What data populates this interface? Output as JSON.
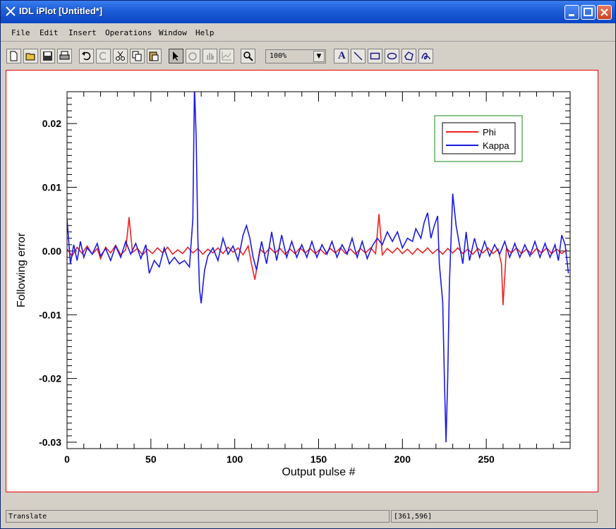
{
  "window": {
    "title": "IDL iPlot [Untitled*]"
  },
  "menu": [
    "File",
    "Edit",
    "Insert",
    "Operations",
    "Window",
    "Help"
  ],
  "toolbar": {
    "zoom": "100%",
    "text_tool": "A"
  },
  "status": {
    "left": "Translate",
    "right": "[361,596]"
  },
  "colors": {
    "phi": "#ee2222",
    "kappa": "#1a1ae6",
    "legend_border": "#1a8a1a",
    "frame": "#dd0000"
  },
  "chart_data": {
    "type": "line",
    "xlabel": "Output pulse #",
    "ylabel": "Following error",
    "xlim": [
      0,
      300
    ],
    "ylim": [
      -0.031,
      0.025
    ],
    "xticks": [
      0,
      50,
      100,
      150,
      200,
      250
    ],
    "xtick_labels": [
      "0",
      "50",
      "100",
      "150",
      "200",
      "250"
    ],
    "yticks": [
      -0.03,
      -0.02,
      -0.01,
      0.0,
      0.01,
      0.02
    ],
    "ytick_labels": [
      "-0.03",
      "-0.02",
      "-0.01",
      "0.00",
      "0.01",
      "0.02"
    ],
    "legend_position": "top-right",
    "series": [
      {
        "name": "Phi",
        "color": "#ee2222",
        "points": [
          [
            0,
            0.0003
          ],
          [
            3,
            -0.0008
          ],
          [
            6,
            0.0006
          ],
          [
            9,
            -0.0004
          ],
          [
            12,
            0.0008
          ],
          [
            15,
            -0.0005
          ],
          [
            18,
            0.0004
          ],
          [
            20,
            -0.0012
          ],
          [
            23,
            0.0006
          ],
          [
            26,
            -0.0003
          ],
          [
            29,
            0.0009
          ],
          [
            32,
            -0.0006
          ],
          [
            35,
            0.0002
          ],
          [
            37,
            0.0053
          ],
          [
            39,
            -0.0002
          ],
          [
            42,
            0.0004
          ],
          [
            45,
            -0.0006
          ],
          [
            48,
            0.0003
          ],
          [
            51,
            -0.0004
          ],
          [
            54,
            0.0005
          ],
          [
            57,
            -0.0003
          ],
          [
            60,
            0.0006
          ],
          [
            63,
            -0.0005
          ],
          [
            66,
            0.0002
          ],
          [
            69,
            -0.0004
          ],
          [
            72,
            0.0006
          ],
          [
            75,
            -0.0003
          ],
          [
            78,
            0.0004
          ],
          [
            81,
            -0.0005
          ],
          [
            84,
            0.0003
          ],
          [
            87,
            -0.0003
          ],
          [
            90,
            0.0005
          ],
          [
            93,
            -0.0004
          ],
          [
            96,
            0.0006
          ],
          [
            99,
            -0.0002
          ],
          [
            102,
            0.0005
          ],
          [
            105,
            -0.0006
          ],
          [
            108,
            0.0008
          ],
          [
            110,
            -0.002
          ],
          [
            112,
            -0.0045
          ],
          [
            115,
            0.0003
          ],
          [
            118,
            -0.0004
          ],
          [
            121,
            0.0005
          ],
          [
            124,
            -0.0003
          ],
          [
            127,
            0.0004
          ],
          [
            130,
            -0.0005
          ],
          [
            133,
            0.0003
          ],
          [
            136,
            -0.0004
          ],
          [
            139,
            0.0005
          ],
          [
            142,
            -0.0003
          ],
          [
            145,
            0.0004
          ],
          [
            148,
            -0.0004
          ],
          [
            151,
            0.0003
          ],
          [
            154,
            -0.0005
          ],
          [
            157,
            0.0004
          ],
          [
            160,
            -0.0003
          ],
          [
            163,
            0.0005
          ],
          [
            166,
            -0.0004
          ],
          [
            169,
            0.0003
          ],
          [
            172,
            -0.0005
          ],
          [
            175,
            0.0004
          ],
          [
            178,
            -0.0003
          ],
          [
            181,
            0.0005
          ],
          [
            184,
            -0.0004
          ],
          [
            186,
            0.0058
          ],
          [
            188,
            -0.0006
          ],
          [
            191,
            0.0004
          ],
          [
            194,
            -0.0003
          ],
          [
            197,
            0.0005
          ],
          [
            200,
            -0.0004
          ],
          [
            203,
            0.0003
          ],
          [
            206,
            -0.0005
          ],
          [
            209,
            0.0004
          ],
          [
            212,
            -0.0003
          ],
          [
            215,
            0.0005
          ],
          [
            218,
            -0.0004
          ],
          [
            221,
            0.0003
          ],
          [
            224,
            -0.0005
          ],
          [
            227,
            0.0004
          ],
          [
            230,
            -0.0003
          ],
          [
            233,
            0.0005
          ],
          [
            236,
            -0.0004
          ],
          [
            239,
            0.0003
          ],
          [
            242,
            -0.0005
          ],
          [
            245,
            0.0004
          ],
          [
            248,
            -0.0003
          ],
          [
            251,
            0.0005
          ],
          [
            254,
            -0.0004
          ],
          [
            257,
            0.0003
          ],
          [
            259,
            -0.002
          ],
          [
            260,
            -0.0085
          ],
          [
            262,
            0.0004
          ],
          [
            265,
            -0.0003
          ],
          [
            268,
            0.0005
          ],
          [
            271,
            -0.0004
          ],
          [
            274,
            0.0003
          ],
          [
            277,
            -0.0005
          ],
          [
            280,
            0.0004
          ],
          [
            283,
            -0.0003
          ],
          [
            286,
            0.0005
          ],
          [
            289,
            -0.0004
          ],
          [
            292,
            0.0003
          ],
          [
            295,
            -0.0004
          ],
          [
            298,
            0.0002
          ]
        ]
      },
      {
        "name": "Kappa",
        "color": "#1a1ae6",
        "points": [
          [
            0,
            0.005
          ],
          [
            2,
            -0.002
          ],
          [
            4,
            0.001
          ],
          [
            6,
            -0.0015
          ],
          [
            8,
            0.0015
          ],
          [
            10,
            -0.001
          ],
          [
            12,
            0.0005
          ],
          [
            15,
            -0.0005
          ],
          [
            18,
            0.0012
          ],
          [
            20,
            -0.0008
          ],
          [
            23,
            0.0004
          ],
          [
            26,
            -0.0015
          ],
          [
            29,
            0.0008
          ],
          [
            32,
            -0.001
          ],
          [
            35,
            0.0015
          ],
          [
            38,
            -0.0005
          ],
          [
            41,
            0.0012
          ],
          [
            44,
            -0.0012
          ],
          [
            47,
            0.001
          ],
          [
            49,
            -0.0035
          ],
          [
            52,
            -0.0015
          ],
          [
            55,
            -0.0025
          ],
          [
            58,
            0.0005
          ],
          [
            61,
            -0.002
          ],
          [
            64,
            -0.001
          ],
          [
            67,
            -0.002
          ],
          [
            70,
            -0.0015
          ],
          [
            73,
            -0.0025
          ],
          [
            75,
            0.005
          ],
          [
            76,
            0.026
          ],
          [
            77,
            0.018
          ],
          [
            78,
            0.002
          ],
          [
            79,
            -0.006
          ],
          [
            80,
            -0.0082
          ],
          [
            82,
            -0.003
          ],
          [
            84,
            -0.0008
          ],
          [
            87,
            0.0005
          ],
          [
            90,
            -0.0015
          ],
          [
            93,
            0.002
          ],
          [
            96,
            -0.0005
          ],
          [
            99,
            0.0008
          ],
          [
            102,
            -0.0015
          ],
          [
            105,
            0.0025
          ],
          [
            107,
            0.004
          ],
          [
            109,
            0.002
          ],
          [
            111,
            -0.001
          ],
          [
            113,
            -0.003
          ],
          [
            116,
            0.0015
          ],
          [
            119,
            -0.002
          ],
          [
            122,
            0.003
          ],
          [
            125,
            -0.0015
          ],
          [
            128,
            0.0025
          ],
          [
            131,
            -0.001
          ],
          [
            134,
            0.0015
          ],
          [
            137,
            -0.001
          ],
          [
            140,
            0.001
          ],
          [
            143,
            -0.001
          ],
          [
            146,
            0.0015
          ],
          [
            149,
            -0.001
          ],
          [
            152,
            0.001
          ],
          [
            155,
            -0.0005
          ],
          [
            158,
            0.0015
          ],
          [
            161,
            -0.001
          ],
          [
            164,
            0.001
          ],
          [
            167,
            -0.0005
          ],
          [
            170,
            0.002
          ],
          [
            173,
            -0.001
          ],
          [
            176,
            0.0015
          ],
          [
            179,
            -0.0012
          ],
          [
            182,
            0.0008
          ],
          [
            185,
            0.002
          ],
          [
            188,
            0.001
          ],
          [
            191,
            0.003
          ],
          [
            194,
            0.0015
          ],
          [
            197,
            0.003
          ],
          [
            200,
            0.0005
          ],
          [
            203,
            0.002
          ],
          [
            206,
            0.0015
          ],
          [
            208,
            0.0035
          ],
          [
            211,
            0.002
          ],
          [
            213,
            0.0045
          ],
          [
            215,
            0.006
          ],
          [
            217,
            0.002
          ],
          [
            219,
            0.004
          ],
          [
            221,
            0.0055
          ],
          [
            222,
            -0.002
          ],
          [
            224,
            -0.008
          ],
          [
            225,
            -0.02
          ],
          [
            226,
            -0.03
          ],
          [
            227,
            -0.02
          ],
          [
            228,
            -0.005
          ],
          [
            229,
            0.002
          ],
          [
            230,
            0.009
          ],
          [
            232,
            0.004
          ],
          [
            234,
            0.001
          ],
          [
            236,
            -0.002
          ],
          [
            238,
            0.003
          ],
          [
            240,
            -0.0015
          ],
          [
            243,
            0.002
          ],
          [
            246,
            -0.001
          ],
          [
            249,
            0.0015
          ],
          [
            252,
            -0.0008
          ],
          [
            255,
            0.001
          ],
          [
            258,
            -0.0005
          ],
          [
            261,
            0.0015
          ],
          [
            264,
            -0.001
          ],
          [
            267,
            0.0012
          ],
          [
            270,
            -0.001
          ],
          [
            273,
            0.001
          ],
          [
            276,
            -0.0008
          ],
          [
            279,
            0.0015
          ],
          [
            282,
            -0.001
          ],
          [
            285,
            0.0012
          ],
          [
            288,
            -0.001
          ],
          [
            291,
            0.001
          ],
          [
            293,
            -0.0015
          ],
          [
            295,
            0.0025
          ],
          [
            297,
            0.001
          ],
          [
            299,
            -0.0035
          ]
        ]
      }
    ]
  }
}
